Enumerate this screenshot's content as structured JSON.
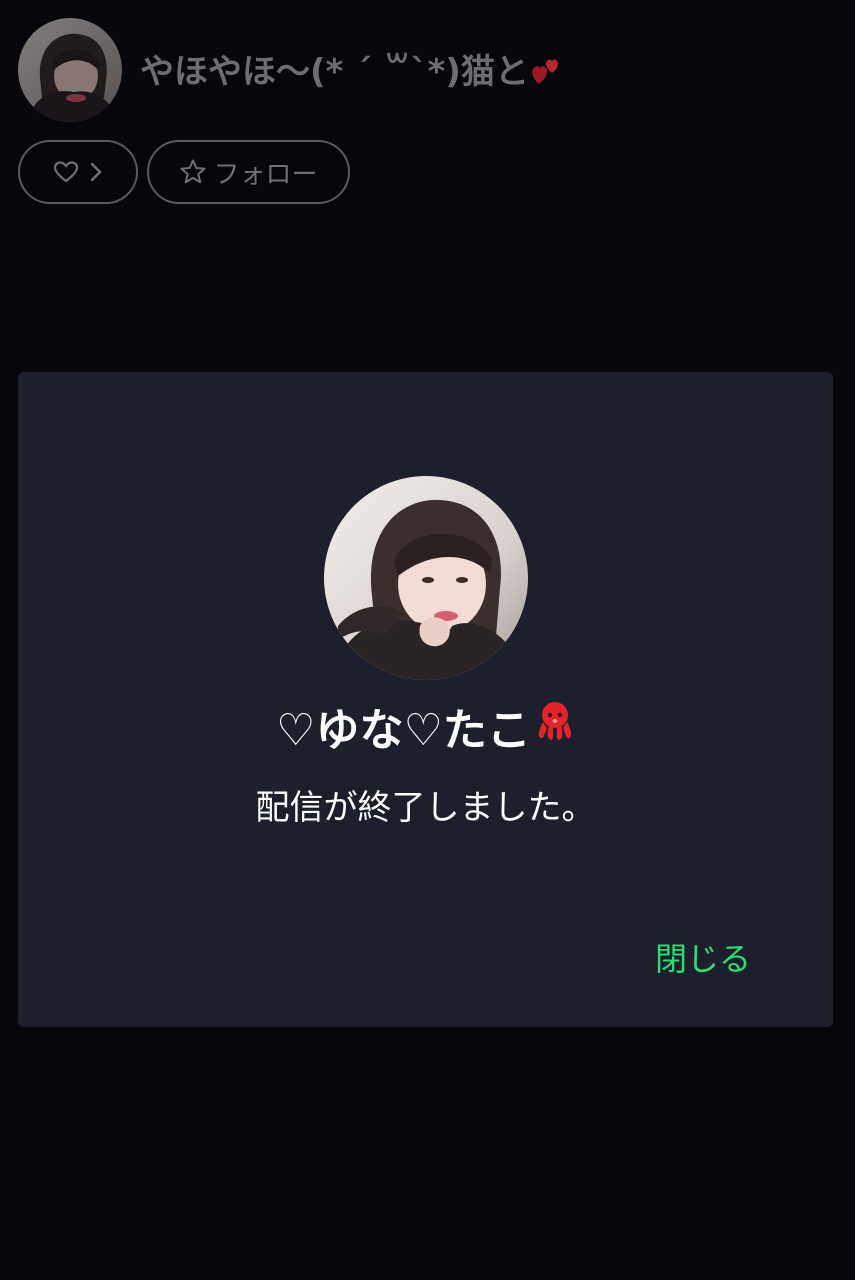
{
  "header": {
    "stream_title": "やほやほ〜(* ´ ꒳`*)猫と",
    "title_hearts_icon": "two-hearts-icon",
    "like_button": {
      "icon": "heart-outline-icon",
      "chevron_icon": "chevron-right-icon"
    },
    "follow_button": {
      "icon": "star-outline-icon",
      "label": "フォロー"
    }
  },
  "modal": {
    "broadcaster_name": "♡ゆな♡たこ",
    "name_emoji_icon": "octopus-icon",
    "end_message": "配信が終了しました。",
    "close_label": "閉じる"
  },
  "colors": {
    "background": "#06060b",
    "modal_background": "#1e1f2d",
    "accent_green": "#2ddc72",
    "muted_text": "#6c6c72"
  }
}
